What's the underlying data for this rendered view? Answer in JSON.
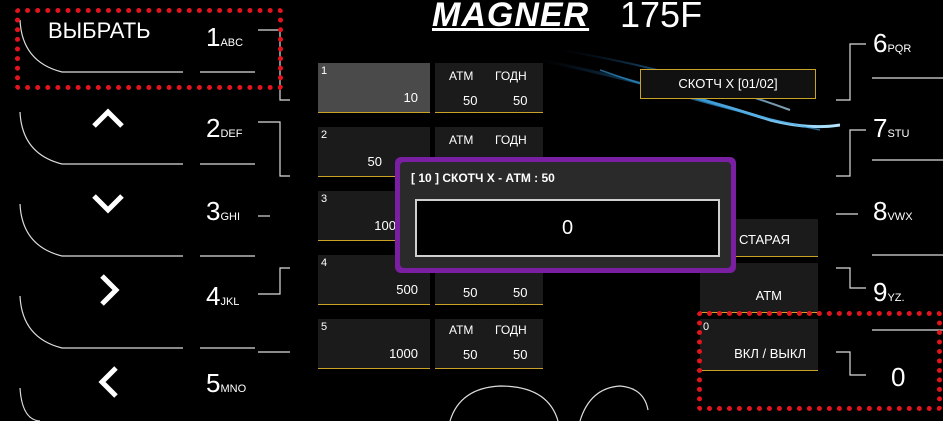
{
  "header": {
    "brand": "MAGNER",
    "model": "175F"
  },
  "left_keys": [
    {
      "label": "ВЫБРАТЬ",
      "icon": "",
      "digit": "1",
      "letters": "ABC"
    },
    {
      "label": "",
      "icon": "chevron-up-icon",
      "digit": "2",
      "letters": "DEF"
    },
    {
      "label": "",
      "icon": "chevron-down-icon",
      "digit": "3",
      "letters": "GHI"
    },
    {
      "label": "",
      "icon": "chevron-right-icon",
      "digit": "4",
      "letters": "JKL"
    },
    {
      "label": "",
      "icon": "chevron-left-icon",
      "digit": "5",
      "letters": "MNO"
    }
  ],
  "right_keys": [
    {
      "digit": "6",
      "letters": "PQR"
    },
    {
      "digit": "7",
      "letters": "STU"
    },
    {
      "digit": "8",
      "letters": "VWX"
    },
    {
      "digit": "9",
      "letters": "YZ."
    },
    {
      "digit": "0",
      "letters": ""
    }
  ],
  "columns": {
    "atm": "АТМ",
    "good": "ГОДН"
  },
  "denominations": [
    {
      "index": "1",
      "value": "10",
      "atm": "50",
      "good": "50"
    },
    {
      "index": "2",
      "value": "50",
      "atm": "",
      "good": ""
    },
    {
      "index": "3",
      "value": "100",
      "atm": "",
      "good": ""
    },
    {
      "index": "4",
      "value": "500",
      "atm": "50",
      "good": "50"
    },
    {
      "index": "5",
      "value": "1000",
      "atm": "50",
      "good": "50"
    }
  ],
  "tape_label": "СКОТЧ X [01/02]",
  "right_options": [
    {
      "index": "",
      "label": "СТАРАЯ"
    },
    {
      "index": "",
      "label": "АТМ"
    },
    {
      "index": "0",
      "label": "ВКЛ / ВЫКЛ"
    }
  ],
  "dialog": {
    "title": "[ 10 ] СКОТЧ X - АТМ : 50",
    "value": "0"
  },
  "colors": {
    "accent": "#c9a227",
    "dialog_border": "#7a1fa2",
    "highlight": "#e3141e"
  }
}
